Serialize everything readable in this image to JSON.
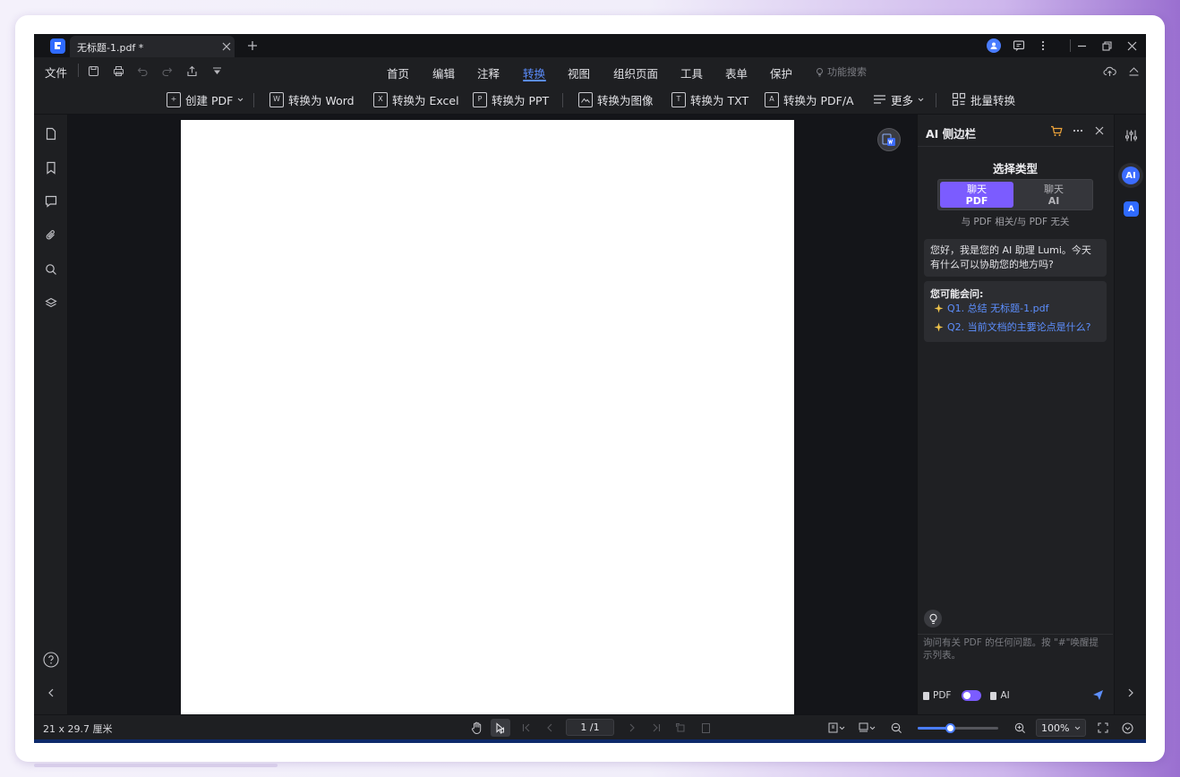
{
  "window": {
    "tab_title": "无标题-1.pdf *",
    "icons": [
      "app-logo-icon",
      "close-icon",
      "plus-icon",
      "avatar-icon",
      "chat-icon",
      "more-icon",
      "minimize-icon",
      "restore-icon",
      "close-icon"
    ]
  },
  "menubar": {
    "file": "文件",
    "items": [
      {
        "label": "首页",
        "active": false
      },
      {
        "label": "编辑",
        "active": false
      },
      {
        "label": "注释",
        "active": false
      },
      {
        "label": "转换",
        "active": true
      },
      {
        "label": "视图",
        "active": false
      },
      {
        "label": "组织页面",
        "active": false
      },
      {
        "label": "工具",
        "active": false
      },
      {
        "label": "表单",
        "active": false
      },
      {
        "label": "保护",
        "active": false
      }
    ],
    "feature_search": "功能搜索"
  },
  "toolbar": {
    "create_pdf": "创建 PDF",
    "to_word": "转换为 Word",
    "to_excel": "转换为 Excel",
    "to_ppt": "转换为 PPT",
    "to_image": "转换为图像",
    "to_txt": "转换为 TXT",
    "to_pdfa": "转换为 PDF/A",
    "more": "更多",
    "batch": "批量转换"
  },
  "ai_panel": {
    "title": "AI 侧边栏",
    "select_title": "选择类型",
    "option_pdf_line1": "聊天",
    "option_pdf_line2": "PDF",
    "option_ai_line1": "聊天",
    "option_ai_line2": "AI",
    "selected": "PDF",
    "caption": "与 PDF 相关/与 PDF 无关",
    "greeting": "您好，我是您的 AI 助理 Lumi。今天有什么可以协助您的地方吗?",
    "suggest_title": "您可能会问:",
    "q1": "Q1. 总结 无标题-1.pdf",
    "q2": "Q2. 当前文档的主要论点是什么?",
    "input_placeholder": "询问有关 PDF 的任何问题。按 \"#\"唤醒提示列表。",
    "footer_pdf": "PDF",
    "footer_ai": "AI"
  },
  "rightrail": {
    "ai_badge": "AI",
    "translate_badge": "A"
  },
  "statusbar": {
    "page_size": "21 x 29.7 厘米",
    "page_indicator": "1 /1",
    "zoom": "100%",
    "zoom_level_percent": 40
  },
  "colors": {
    "accent": "#5b8dff",
    "ai_purple": "#7b5cff",
    "app_bg": "#1e1f22",
    "doc_bg": "#141519"
  }
}
